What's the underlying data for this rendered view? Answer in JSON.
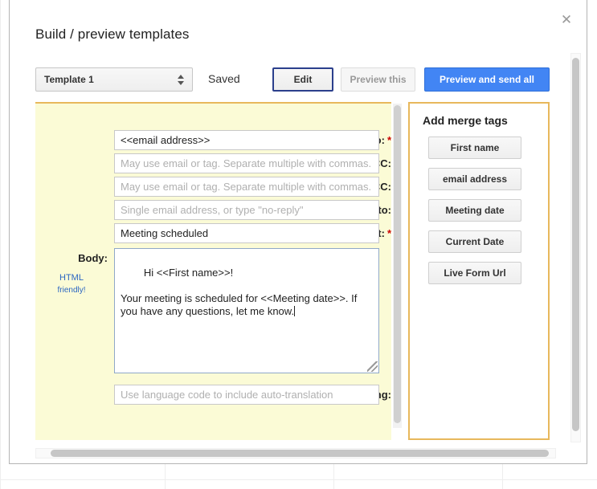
{
  "dialog": {
    "title": "Build / preview templates",
    "close_icon": "close-icon",
    "close_glyph": "✕"
  },
  "toolbar": {
    "template_select": {
      "selected": "Template 1",
      "options": [
        "Template 1"
      ],
      "arrows_icon": "updown-arrows-icon"
    },
    "status": "Saved",
    "edit_label": "Edit",
    "preview_this_label": "Preview this",
    "preview_send_all_label": "Preview and send all"
  },
  "compose": {
    "fields": [
      {
        "name": "to",
        "label": "To:",
        "required": true,
        "value": "<<email address>>",
        "placeholder": "",
        "is_placeholder": false
      },
      {
        "name": "cc",
        "label": "CC:",
        "required": false,
        "value": "",
        "placeholder": "May use email or tag. Separate multiple with commas.",
        "is_placeholder": true
      },
      {
        "name": "bcc",
        "label": "BCC:",
        "required": false,
        "value": "",
        "placeholder": "May use email or tag. Separate multiple with commas.",
        "is_placeholder": true
      },
      {
        "name": "reply-to",
        "label": "Reply-to:",
        "required": false,
        "value": "",
        "placeholder": "Single email address, or type \"no-reply\"",
        "is_placeholder": true
      },
      {
        "name": "subject",
        "label": "Subject:",
        "required": true,
        "value": "Meeting scheduled",
        "placeholder": "",
        "is_placeholder": false
      }
    ],
    "body": {
      "label": "Body:",
      "html_friendly_line1": "HTML",
      "html_friendly_line2": "friendly!",
      "value": "Hi <<First name>>!\n\nYour meeting is scheduled for <<Meeting date>>. If you have any questions, let me know."
    },
    "lang": {
      "label": "Lang:",
      "value": "",
      "placeholder": "Use language code to include auto-translation",
      "is_placeholder": true
    },
    "required_marker": "*"
  },
  "merge_tags": {
    "title": "Add merge tags",
    "buttons": [
      "First name",
      "email address",
      "Meeting date",
      "Current Date",
      "Live Form Url"
    ]
  },
  "colors": {
    "compose_background": "#fbfbd6",
    "panel_border": "#e8b85c",
    "primary_button": "#4285f4",
    "focus_border": "#2b3f8c",
    "link": "#2b66c2",
    "required": "#cc0000"
  }
}
